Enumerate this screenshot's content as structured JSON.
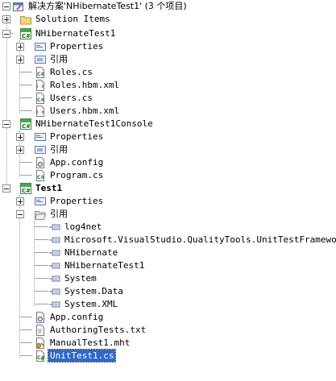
{
  "solution": {
    "label": "解决方案'NHibernateTest1' (3 个项目)"
  },
  "items": [
    {
      "label": "Solution Items",
      "icon": "folder-icon"
    },
    {
      "label": "NHibernateTest1",
      "icon": "csharp-project-icon"
    },
    {
      "label": "Properties",
      "icon": "properties-icon"
    },
    {
      "label": "引用",
      "icon": "references-icon"
    },
    {
      "label": "Roles.cs",
      "icon": "cs-file-icon"
    },
    {
      "label": "Roles.hbm.xml",
      "icon": "xml-file-icon"
    },
    {
      "label": "Users.cs",
      "icon": "cs-file-icon"
    },
    {
      "label": "Users.hbm.xml",
      "icon": "xml-file-icon"
    },
    {
      "label": "NHibernateTest1Console",
      "icon": "csharp-project-icon"
    },
    {
      "label": "Properties",
      "icon": "properties-icon"
    },
    {
      "label": "引用",
      "icon": "references-icon"
    },
    {
      "label": "App.config",
      "icon": "config-file-icon"
    },
    {
      "label": "Program.cs",
      "icon": "cs-file-icon"
    },
    {
      "label": "Test1",
      "icon": "csharp-project-icon"
    },
    {
      "label": "Properties",
      "icon": "properties-icon"
    },
    {
      "label": "引用",
      "icon": "references-icon"
    },
    {
      "label": "log4net",
      "icon": "reference-icon"
    },
    {
      "label": "Microsoft.VisualStudio.QualityTools.UnitTestFramework",
      "icon": "reference-icon"
    },
    {
      "label": "NHibernate",
      "icon": "reference-icon"
    },
    {
      "label": "NHibernateTest1",
      "icon": "reference-icon"
    },
    {
      "label": "System",
      "icon": "reference-icon"
    },
    {
      "label": "System.Data",
      "icon": "reference-icon"
    },
    {
      "label": "System.XML",
      "icon": "reference-icon"
    },
    {
      "label": "App.config",
      "icon": "config-file-icon"
    },
    {
      "label": "AuthoringTests.txt",
      "icon": "text-file-icon"
    },
    {
      "label": "ManualTest1.mht",
      "icon": "manual-test-icon"
    },
    {
      "label": "UnitTest1.cs",
      "icon": "test-cs-file-icon"
    }
  ]
}
